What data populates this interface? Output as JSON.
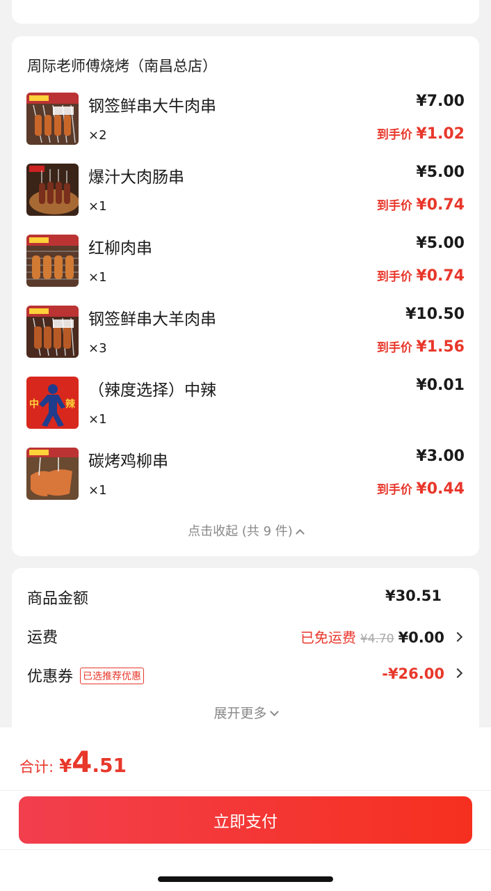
{
  "store": {
    "name": "周际老师傅烧烤（南昌总店）",
    "items": [
      {
        "name": "钢签鲜串大牛肉串",
        "qty": "×2",
        "price": "¥7.00",
        "deal_label": "到手价",
        "deal_price": "¥1.02"
      },
      {
        "name": "爆汁大肉肠串",
        "qty": "×1",
        "price": "¥5.00",
        "deal_label": "到手价",
        "deal_price": "¥0.74"
      },
      {
        "name": "红柳肉串",
        "qty": "×1",
        "price": "¥5.00",
        "deal_label": "到手价",
        "deal_price": "¥0.74"
      },
      {
        "name": "钢签鲜串大羊肉串",
        "qty": "×3",
        "price": "¥10.50",
        "deal_label": "到手价",
        "deal_price": "¥1.56"
      },
      {
        "name": "（辣度选择）中辣",
        "qty": "×1",
        "price": "¥0.01",
        "deal_label": "",
        "deal_price": ""
      },
      {
        "name": "碳烤鸡柳串",
        "qty": "×1",
        "price": "¥3.00",
        "deal_label": "到手价",
        "deal_price": "¥0.44"
      }
    ],
    "collapse_label": "点击收起 (共 9 件)"
  },
  "summary": {
    "goods_label": "商品金额",
    "goods_value": "¥30.51",
    "shipping_label": "运费",
    "shipping_free": "已免运费",
    "shipping_original": "¥4.70",
    "shipping_value": "¥0.00",
    "coupon_label": "优惠券",
    "coupon_badge": "已选推荐优惠",
    "coupon_value": "-¥26.00",
    "expand_label": "展开更多"
  },
  "footer": {
    "total_label": "合计:",
    "currency": "¥",
    "total_int": "4",
    "total_dec": ".51",
    "pay_button": "立即支付"
  },
  "colors": {
    "accent": "#e8372b",
    "button_start": "#f23f4e",
    "button_end": "#f6301f"
  }
}
